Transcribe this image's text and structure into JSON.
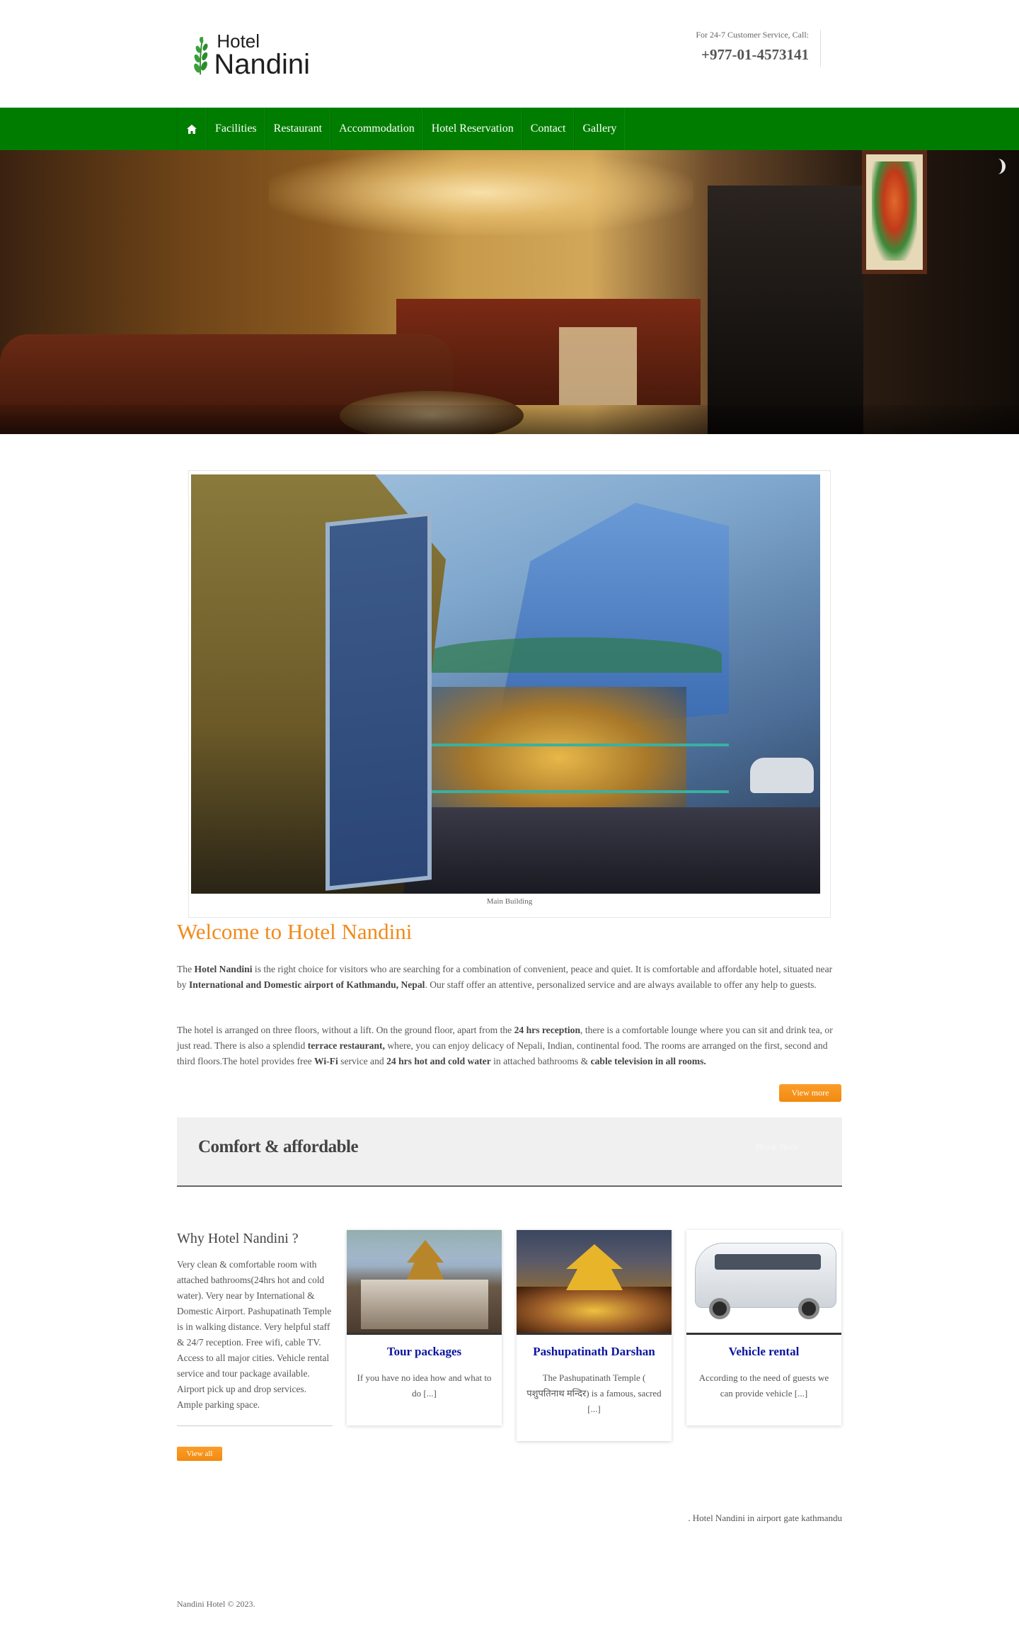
{
  "header": {
    "logo_line1": "Hotel",
    "logo_line2": "Nandini",
    "contact_label": "For 24-7 Customer Service, Call:",
    "phone": "+977-01-4573141"
  },
  "nav": {
    "home_icon": "home-icon",
    "items": [
      "Facilities",
      "Restaurant",
      "Accommodation",
      "Hotel Reservation",
      "Contact",
      "Gallery"
    ]
  },
  "hero": {
    "slider_icon": "slider-next-icon"
  },
  "featured": {
    "caption": "Main Building"
  },
  "welcome": {
    "title": "Welcome to Hotel Nandini",
    "p1": {
      "t1": "The ",
      "b1": "Hotel Nandini",
      "t2": " is the right choice for visitors who are searching for a combination of convenient, peace and quiet. It is  comfortable and affordable hotel, situated near by ",
      "b2": "International and Domestic airport of Kathmandu, Nepal",
      "t3": ". Our staff offer an attentive, personalized service and are always available to offer any help to guests."
    },
    "p2": {
      "t1": "The hotel is arranged on three floors, without a lift. On the ground floor, apart from the ",
      "b1": "24 hrs  reception",
      "t2": ", there is a comfortable lounge where you can sit and drink tea, or just read. There is also a splendid ",
      "b2": "terrace restaurant,",
      "t3": " where, you can enjoy delicacy of Nepali, Indian, continental food. The rooms are arranged on the first, second and third floors.The hotel provides free ",
      "b3": "Wi-Fi",
      "t4": " service and ",
      "b4": "24 hrs hot and cold water",
      "t5": " in attached bathrooms &  ",
      "b5": "cable television in all rooms."
    },
    "view_more": "View more"
  },
  "banner": {
    "title": "Comfort & affordable",
    "book_now": "Book Now"
  },
  "why": {
    "title": "Why Hotel Nandini ?",
    "text": "Very clean & comfortable room with attached bathrooms(24hrs hot and cold water). Very near by International & Domestic Airport. Pashupatinath Temple is in walking distance. Very helpful staff & 24/7 reception. Free wifi, cable TV. Access to all major cities. Vehicle rental service and tour package available. Airport pick up and drop services. Ample parking space.",
    "view_all": "View all"
  },
  "cards": [
    {
      "title": "Tour packages",
      "text": "If you have no idea how and what to do [...]"
    },
    {
      "title": "Pashupatinath Darshan",
      "text": "The Pashupatinath Temple ( पशुपतिनाथ मन्दिर) is a famous, sacred [...]"
    },
    {
      "title": "Vehicle rental",
      "text": "According to the need of guests we can provide vehicle [...]"
    }
  ],
  "footer": {
    "tagline": ". Hotel Nandini in airport gate kathmandu",
    "copyright": "Nandini Hotel © 2023."
  },
  "colors": {
    "nav_green": "#007d00",
    "accent_orange": "#f28a1a",
    "card_title_blue": "#0a14a0"
  }
}
